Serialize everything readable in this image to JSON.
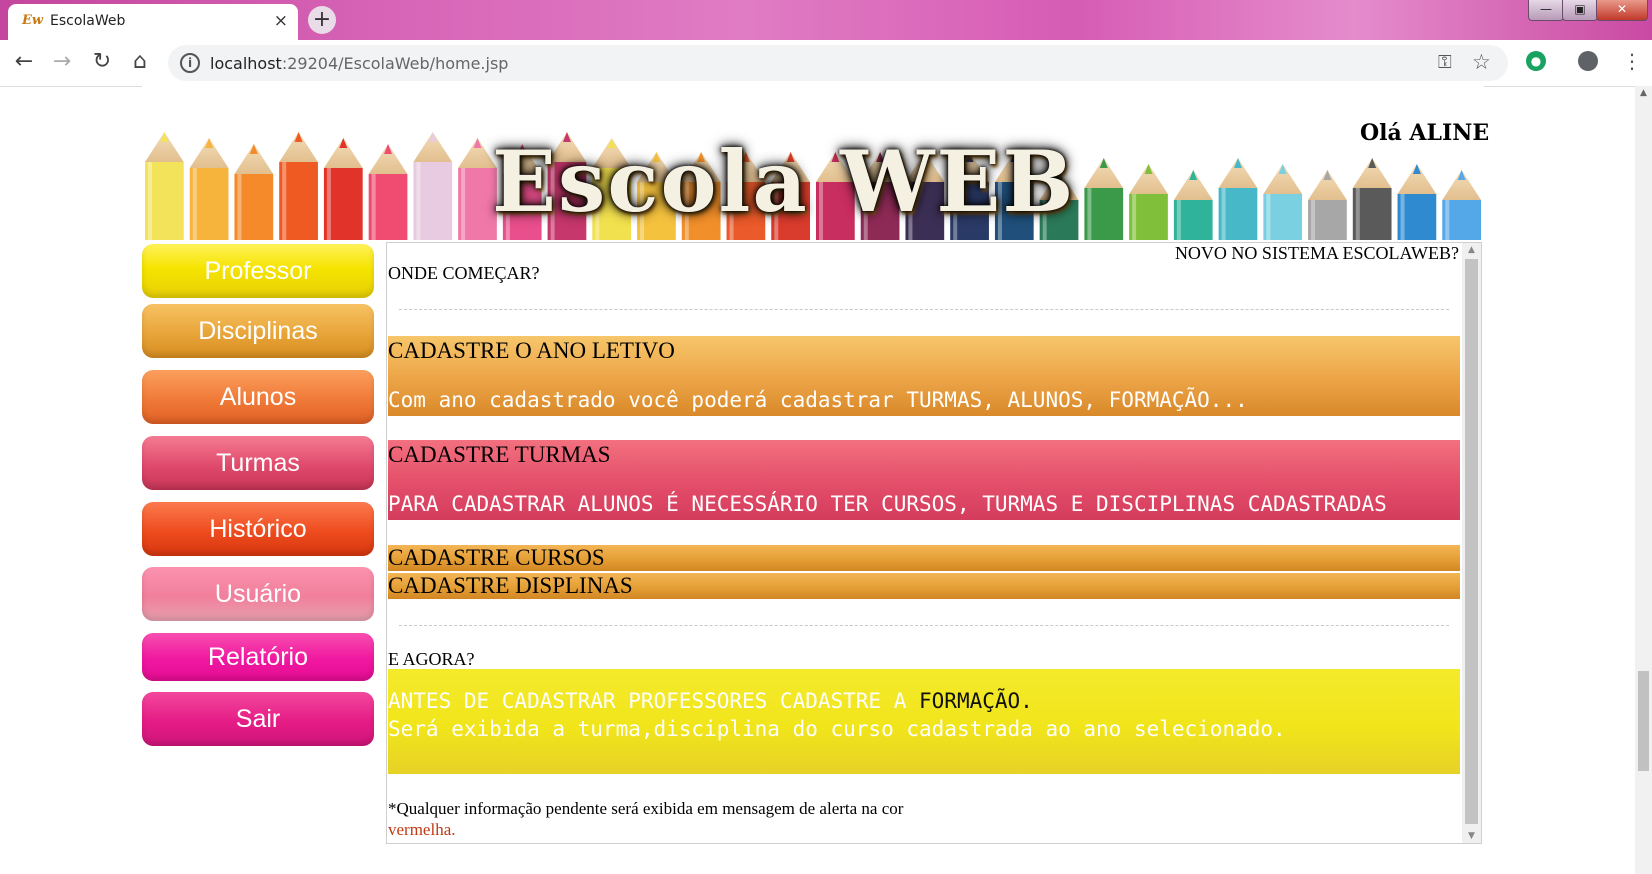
{
  "browser": {
    "tab_title": "EscolaWeb",
    "tab_favicon": "Ew",
    "tab_close": "×",
    "new_tab": "+",
    "window_buttons": {
      "minimize": "—",
      "maximize": "▣",
      "close": "✕"
    },
    "nav": {
      "back": "←",
      "forward": "→",
      "reload": "↻",
      "home": "⌂"
    },
    "url_host": "localhost",
    "url_rest": ":29204/EscolaWeb/home.jsp",
    "info_icon": "i",
    "key_icon": "⚿",
    "star_icon": "☆",
    "menu_icon": "⋮"
  },
  "header": {
    "logo": "Escola WEB",
    "greeting": "Olá ALINE"
  },
  "sidebar": {
    "items": [
      {
        "label": "Professor"
      },
      {
        "label": "Disciplinas"
      },
      {
        "label": "Alunos"
      },
      {
        "label": "Turmas"
      },
      {
        "label": "Histórico"
      },
      {
        "label": "Usuário"
      },
      {
        "label": "Relatório"
      },
      {
        "label": "Sair"
      }
    ]
  },
  "content": {
    "novo_sistema": "NOVO NO SISTEMA ESCOLAWEB?",
    "onde_comecar": "ONDE COMEÇAR?",
    "ano_letivo": {
      "title": "CADASTRE O ANO LETIVO",
      "description": "Com ano cadastrado você poderá cadastrar TURMAS, ALUNOS, FORMAÇÃO..."
    },
    "turmas": {
      "title": "CADASTRE TURMAS",
      "description": "PARA CADASTRAR ALUNOS É NECESSÁRIO TER CURSOS, TURMAS E DISCIPLINAS CADASTRADAS"
    },
    "cursos_title": "CADASTRE CURSOS",
    "disciplinas_title": "CADASTRE DISPLINAS",
    "e_agora": "E AGORA?",
    "formacao": {
      "line1_prefix": "ANTES DE CADASTRAR PROFESSORES CADASTRE A ",
      "line1_highlight": "FORMAÇÃO.",
      "line2": "Será exibida a turma,disciplina do curso cadastrada ao ano selecionado."
    },
    "note": "*Qualquer informação pendente será exibida em mensagem de alerta na cor",
    "note_red": "vermelha."
  }
}
